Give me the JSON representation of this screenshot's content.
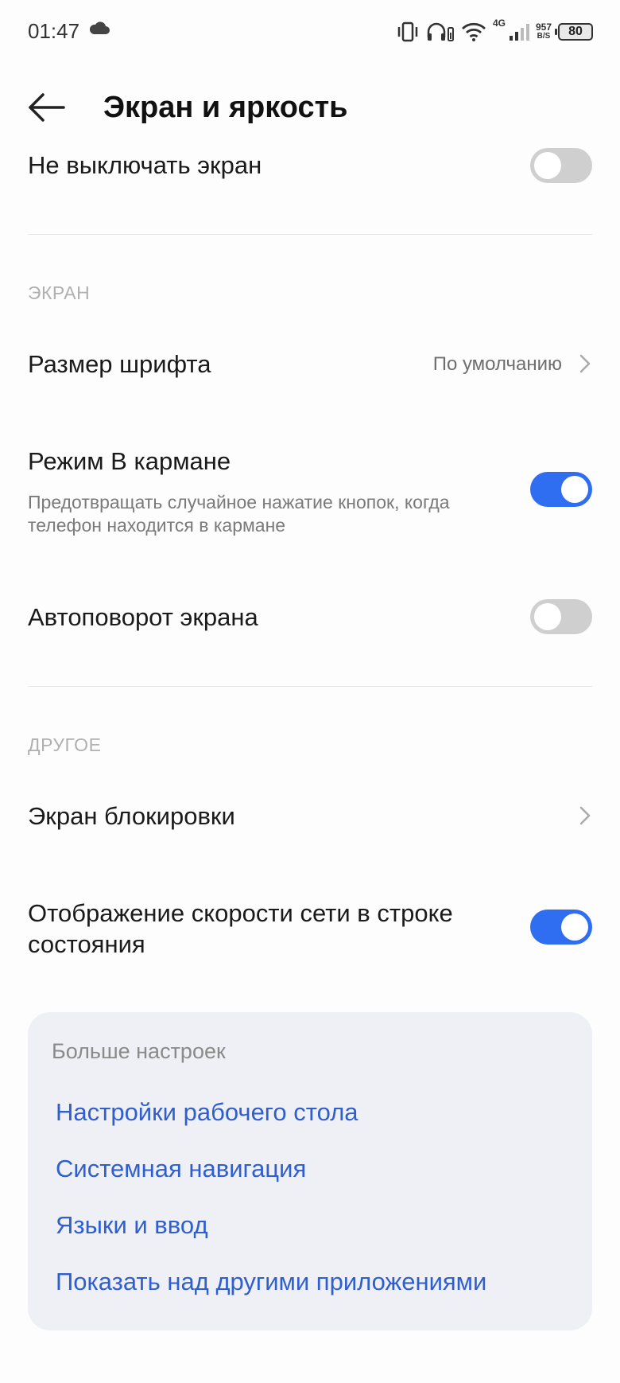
{
  "status_bar": {
    "time": "01:47",
    "network_type": "4G",
    "net_speed_value": "957",
    "net_speed_unit": "B/S",
    "battery": "80"
  },
  "header": {
    "title": "Экран и яркость"
  },
  "settings": {
    "keep_screen_on": {
      "label": "Не выключать экран",
      "enabled": false
    },
    "section_screen": "ЭКРАН",
    "font_size": {
      "label": "Размер шрифта",
      "value": "По умолчанию"
    },
    "pocket_mode": {
      "label": "Режим В кармане",
      "description": "Предотвращать случайное нажатие кнопок, когда телефон находится в кармане",
      "enabled": true
    },
    "auto_rotate": {
      "label": "Автоповорот экрана",
      "enabled": false
    },
    "section_other": "ДРУГОЕ",
    "lock_screen": {
      "label": "Экран блокировки"
    },
    "network_speed": {
      "label": "Отображение скорости сети в строке состояния",
      "enabled": true
    }
  },
  "more_settings": {
    "title": "Больше настроек",
    "links": [
      "Настройки рабочего стола",
      "Системная навигация",
      "Языки и ввод",
      "Показать над другими приложениями"
    ]
  },
  "colors": {
    "accent": "#2f6ef0",
    "link": "#2f5fcf",
    "toggle_off": "#cfcfcf",
    "card_bg": "#eff0f5"
  }
}
